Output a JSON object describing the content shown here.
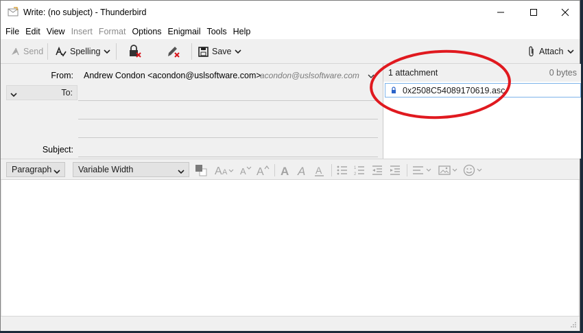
{
  "window": {
    "title": "Write: (no subject) - Thunderbird"
  },
  "menu": [
    {
      "label": "File",
      "disabled": false
    },
    {
      "label": "Edit",
      "disabled": false
    },
    {
      "label": "View",
      "disabled": false
    },
    {
      "label": "Insert",
      "disabled": true
    },
    {
      "label": "Format",
      "disabled": true
    },
    {
      "label": "Options",
      "disabled": false
    },
    {
      "label": "Enigmail",
      "disabled": false
    },
    {
      "label": "Tools",
      "disabled": false
    },
    {
      "label": "Help",
      "disabled": false
    }
  ],
  "toolbar": {
    "send_label": "Send",
    "spelling_label": "Spelling",
    "save_label": "Save",
    "attach_label": "Attach"
  },
  "header": {
    "from_label": "From:",
    "from_value": "Andrew Condon <acondon@uslsoftware.com>",
    "from_identity": "acondon@uslsoftware.com",
    "to_label": "To:",
    "subject_label": "Subject:"
  },
  "attachments": {
    "count_label": "1 attachment",
    "total_size": "0 bytes",
    "items": [
      {
        "name": "0x2508C54089170619.asc"
      }
    ]
  },
  "format": {
    "paragraph_value": "Paragraph",
    "font_value": "Variable Width"
  },
  "colors": {
    "annotation": "#e0191f",
    "selection_border": "#7eb4ea",
    "lock_blue": "#2a63c9",
    "red_x": "#d8141a"
  }
}
